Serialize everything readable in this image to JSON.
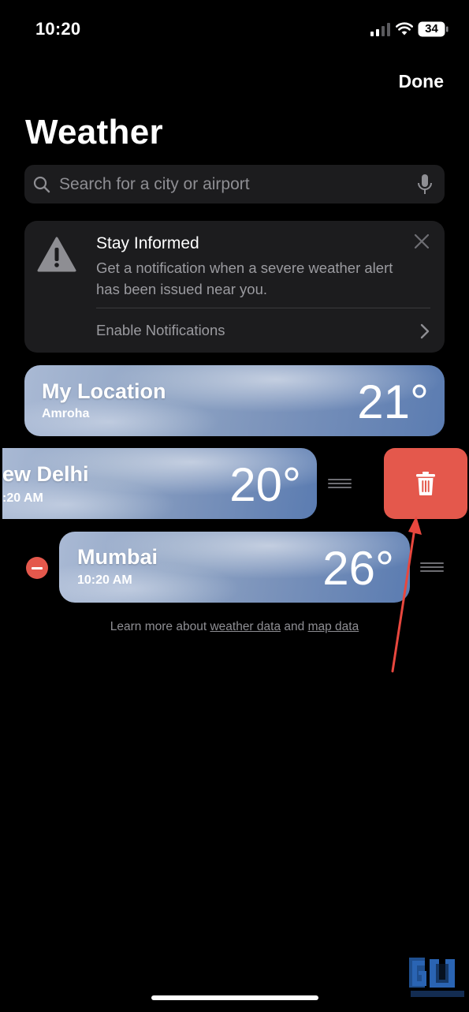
{
  "status_bar": {
    "time": "10:20",
    "battery": "34"
  },
  "header": {
    "done_label": "Done",
    "title": "Weather"
  },
  "search": {
    "placeholder": "Search for a city or airport"
  },
  "alert": {
    "title": "Stay Informed",
    "body": "Get a notification when a severe weather alert has been issued near you.",
    "action": "Enable Notifications"
  },
  "locations": [
    {
      "name": "My Location",
      "subtitle": "Amroha",
      "temp": "21°"
    },
    {
      "name": "ew Delhi",
      "subtitle": ":20 AM",
      "temp": "20°"
    },
    {
      "name": "Mumbai",
      "subtitle": "10:20 AM",
      "temp": "26°"
    }
  ],
  "footer": {
    "prefix": "Learn more about ",
    "link1": "weather data",
    "middle": " and ",
    "link2": "map data"
  },
  "colors": {
    "delete": "#e4584c",
    "annotation_arrow": "#e8473e",
    "card_gradient_end": "#5b7cb1"
  },
  "icons": [
    "search-icon",
    "microphone-icon",
    "warning-icon",
    "close-icon",
    "chevron-right-icon",
    "trash-icon",
    "minus-icon",
    "drag-handle-icon"
  ]
}
